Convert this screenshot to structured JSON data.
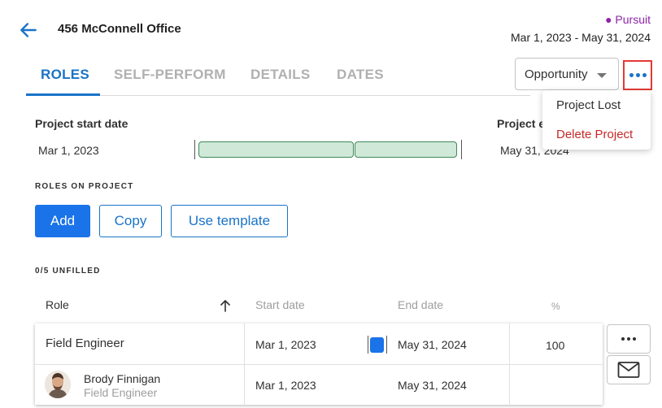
{
  "header": {
    "title": "456 McConnell Office",
    "status": "● Pursuit",
    "date_range": "Mar 1, 2023 - May 31, 2024"
  },
  "tabs": [
    {
      "label": "ROLES",
      "active": true
    },
    {
      "label": "SELF-PERFORM",
      "active": false
    },
    {
      "label": "DETAILS",
      "active": false
    },
    {
      "label": "DATES",
      "active": false
    }
  ],
  "stage_select": {
    "value": "Opportunity"
  },
  "menu": {
    "items": [
      {
        "label": "Project Lost"
      },
      {
        "label": "Delete Project"
      }
    ]
  },
  "project_dates": {
    "start_label": "Project start date",
    "start_value": "Mar 1, 2023",
    "end_label": "Project e",
    "end_value": "May 31, 2024"
  },
  "roles_section": {
    "title": "ROLES ON PROJECT",
    "add_label": "Add",
    "copy_label": "Copy",
    "template_label": "Use template",
    "unfilled": "0/5 UNFILLED"
  },
  "table": {
    "headers": {
      "role": "Role",
      "start": "Start date",
      "end": "End date",
      "percent": "%"
    },
    "rows": [
      {
        "role": "Field Engineer",
        "start": "Mar 1, 2023",
        "end": "May 31, 2024",
        "percent": "100"
      },
      {
        "name": "Brody Finnigan",
        "role": "Field Engineer",
        "start": "Mar 1, 2023",
        "end": "May 31, 2024",
        "percent": ""
      }
    ]
  },
  "colors": {
    "accent": "#1a73c8",
    "primary_button": "#1a73e8",
    "status": "#8e24aa",
    "danger": "#c62828",
    "highlight_border": "#e53935",
    "bar_fill": "#cfe8d8",
    "bar_border": "#3f8a5c"
  },
  "icons": {
    "back": "arrow-left-icon",
    "more": "more-horizontal-icon",
    "sort": "arrow-up-icon",
    "mail": "mail-icon"
  }
}
